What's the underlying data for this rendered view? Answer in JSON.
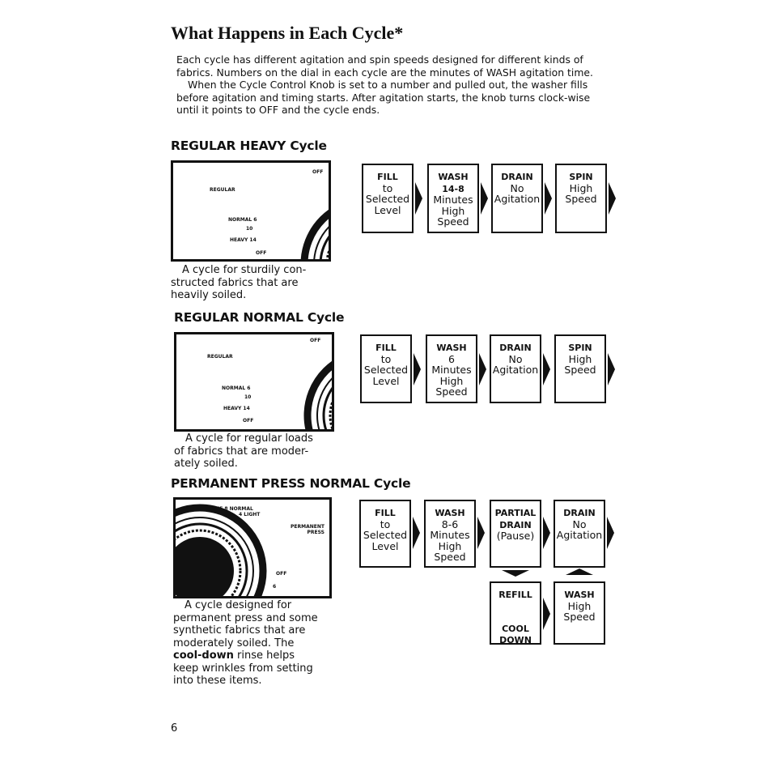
{
  "title": "What Happens in Each Cycle*",
  "intro": [
    "Each cycle has different agitation and spin speeds designed for different kinds of fabrics. Numbers on the dial in each cycle are the minutes of WASH agitation time.",
    "When the Cycle Control Knob is set to a number and pulled out, the washer fills before agitation and timing starts. After agitation starts, the knob turns clock-wise until it points to OFF and the cycle ends."
  ],
  "sections": [
    {
      "heading": "REGULAR HEAVY Cycle",
      "dial_labels": [
        "REGULAR",
        "OFF",
        "NORMAL 6",
        "10",
        "HEAVY 14",
        "OFF"
      ],
      "caption": "A cycle for sturdily con-structed fabrics that are heavily soiled.",
      "steps": [
        {
          "title": "FILL",
          "lines": [
            "to",
            "Selected",
            "Level"
          ]
        },
        {
          "title": "WASH",
          "lines": [
            "14-8",
            "Minutes",
            "High",
            "Speed"
          ]
        },
        {
          "title": "DRAIN",
          "lines": [
            "No",
            "Agitation"
          ]
        },
        {
          "title": "SPIN",
          "lines": [
            "High",
            "Speed"
          ]
        }
      ]
    },
    {
      "heading": "REGULAR NORMAL Cycle",
      "dial_labels": [
        "REGULAR",
        "OFF",
        "NORMAL 6",
        "10",
        "HEAVY 14",
        "OFF"
      ],
      "caption": "A cycle for regular loads of fabrics that are moder-ately soiled.",
      "steps": [
        {
          "title": "FILL",
          "lines": [
            "to",
            "Selected",
            "Level"
          ]
        },
        {
          "title": "WASH",
          "lines": [
            "6",
            "Minutes",
            "High",
            "Speed"
          ]
        },
        {
          "title": "DRAIN",
          "lines": [
            "No",
            "Agitation"
          ]
        },
        {
          "title": "SPIN",
          "lines": [
            "High",
            "Speed"
          ]
        }
      ]
    },
    {
      "heading": "PERMANENT PRESS NORMAL Cycle",
      "dial_labels": [
        "PERMANENT PRESS",
        "OFF 8 NORMAL",
        "4 LIGHT",
        "OFF",
        "6"
      ],
      "caption_pre": "A cycle designed for permanent press and some synthetic fabrics that are moderately soiled. The ",
      "caption_bold": "cool-down",
      "caption_post": " rinse helps keep wrinkles from setting into these items.",
      "steps": [
        {
          "title": "FILL",
          "lines": [
            "to",
            "Selected",
            "Level"
          ]
        },
        {
          "title": "WASH",
          "lines": [
            "8-6",
            "Minutes",
            "High",
            "Speed"
          ]
        },
        {
          "title": "PARTIAL DRAIN",
          "lines": [
            "(Pause)"
          ]
        },
        {
          "title": "DRAIN",
          "lines": [
            "No",
            "Agitation"
          ]
        },
        {
          "title": "REFILL",
          "lines": [
            "",
            "",
            "COOL DOWN"
          ]
        },
        {
          "title": "WASH",
          "lines": [
            "High",
            "Speed"
          ]
        }
      ]
    }
  ],
  "page_number": "6"
}
